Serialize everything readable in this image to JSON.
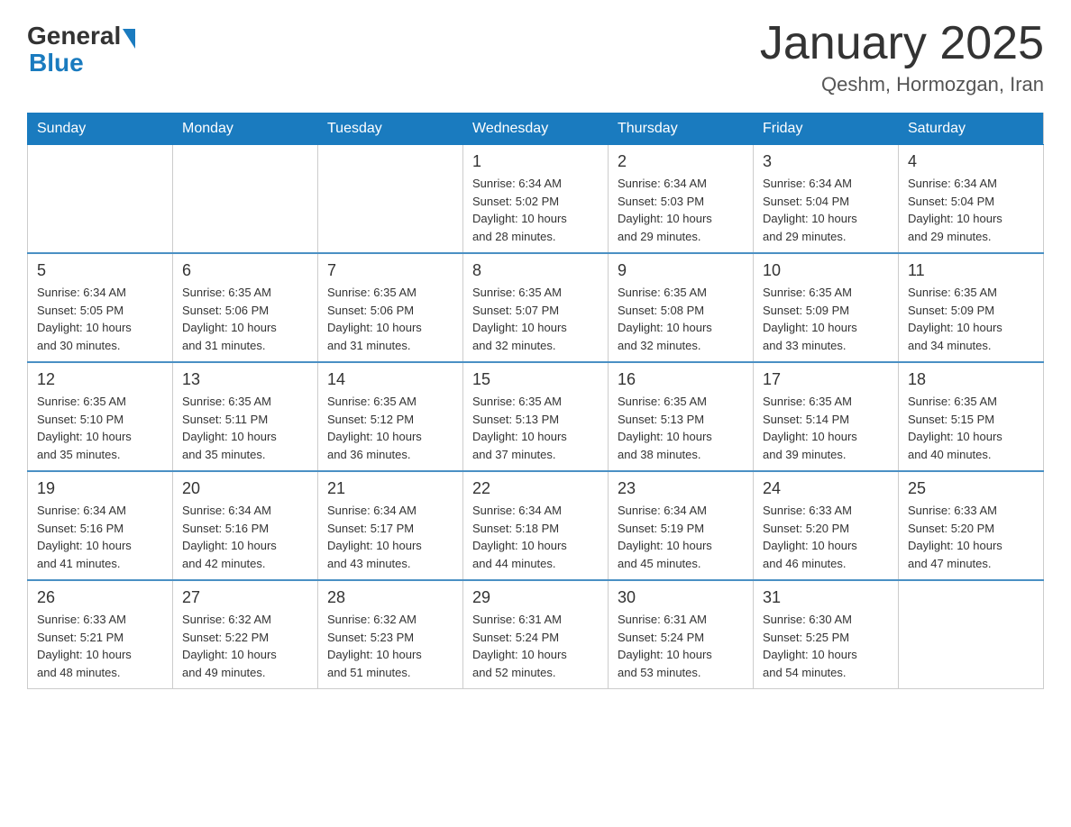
{
  "header": {
    "logo": {
      "general": "General",
      "blue": "Blue",
      "line2": "Blue"
    },
    "title": "January 2025",
    "location": "Qeshm, Hormozgan, Iran"
  },
  "days_of_week": [
    "Sunday",
    "Monday",
    "Tuesday",
    "Wednesday",
    "Thursday",
    "Friday",
    "Saturday"
  ],
  "weeks": [
    [
      {
        "day": "",
        "info": ""
      },
      {
        "day": "",
        "info": ""
      },
      {
        "day": "",
        "info": ""
      },
      {
        "day": "1",
        "info": "Sunrise: 6:34 AM\nSunset: 5:02 PM\nDaylight: 10 hours\nand 28 minutes."
      },
      {
        "day": "2",
        "info": "Sunrise: 6:34 AM\nSunset: 5:03 PM\nDaylight: 10 hours\nand 29 minutes."
      },
      {
        "day": "3",
        "info": "Sunrise: 6:34 AM\nSunset: 5:04 PM\nDaylight: 10 hours\nand 29 minutes."
      },
      {
        "day": "4",
        "info": "Sunrise: 6:34 AM\nSunset: 5:04 PM\nDaylight: 10 hours\nand 29 minutes."
      }
    ],
    [
      {
        "day": "5",
        "info": "Sunrise: 6:34 AM\nSunset: 5:05 PM\nDaylight: 10 hours\nand 30 minutes."
      },
      {
        "day": "6",
        "info": "Sunrise: 6:35 AM\nSunset: 5:06 PM\nDaylight: 10 hours\nand 31 minutes."
      },
      {
        "day": "7",
        "info": "Sunrise: 6:35 AM\nSunset: 5:06 PM\nDaylight: 10 hours\nand 31 minutes."
      },
      {
        "day": "8",
        "info": "Sunrise: 6:35 AM\nSunset: 5:07 PM\nDaylight: 10 hours\nand 32 minutes."
      },
      {
        "day": "9",
        "info": "Sunrise: 6:35 AM\nSunset: 5:08 PM\nDaylight: 10 hours\nand 32 minutes."
      },
      {
        "day": "10",
        "info": "Sunrise: 6:35 AM\nSunset: 5:09 PM\nDaylight: 10 hours\nand 33 minutes."
      },
      {
        "day": "11",
        "info": "Sunrise: 6:35 AM\nSunset: 5:09 PM\nDaylight: 10 hours\nand 34 minutes."
      }
    ],
    [
      {
        "day": "12",
        "info": "Sunrise: 6:35 AM\nSunset: 5:10 PM\nDaylight: 10 hours\nand 35 minutes."
      },
      {
        "day": "13",
        "info": "Sunrise: 6:35 AM\nSunset: 5:11 PM\nDaylight: 10 hours\nand 35 minutes."
      },
      {
        "day": "14",
        "info": "Sunrise: 6:35 AM\nSunset: 5:12 PM\nDaylight: 10 hours\nand 36 minutes."
      },
      {
        "day": "15",
        "info": "Sunrise: 6:35 AM\nSunset: 5:13 PM\nDaylight: 10 hours\nand 37 minutes."
      },
      {
        "day": "16",
        "info": "Sunrise: 6:35 AM\nSunset: 5:13 PM\nDaylight: 10 hours\nand 38 minutes."
      },
      {
        "day": "17",
        "info": "Sunrise: 6:35 AM\nSunset: 5:14 PM\nDaylight: 10 hours\nand 39 minutes."
      },
      {
        "day": "18",
        "info": "Sunrise: 6:35 AM\nSunset: 5:15 PM\nDaylight: 10 hours\nand 40 minutes."
      }
    ],
    [
      {
        "day": "19",
        "info": "Sunrise: 6:34 AM\nSunset: 5:16 PM\nDaylight: 10 hours\nand 41 minutes."
      },
      {
        "day": "20",
        "info": "Sunrise: 6:34 AM\nSunset: 5:16 PM\nDaylight: 10 hours\nand 42 minutes."
      },
      {
        "day": "21",
        "info": "Sunrise: 6:34 AM\nSunset: 5:17 PM\nDaylight: 10 hours\nand 43 minutes."
      },
      {
        "day": "22",
        "info": "Sunrise: 6:34 AM\nSunset: 5:18 PM\nDaylight: 10 hours\nand 44 minutes."
      },
      {
        "day": "23",
        "info": "Sunrise: 6:34 AM\nSunset: 5:19 PM\nDaylight: 10 hours\nand 45 minutes."
      },
      {
        "day": "24",
        "info": "Sunrise: 6:33 AM\nSunset: 5:20 PM\nDaylight: 10 hours\nand 46 minutes."
      },
      {
        "day": "25",
        "info": "Sunrise: 6:33 AM\nSunset: 5:20 PM\nDaylight: 10 hours\nand 47 minutes."
      }
    ],
    [
      {
        "day": "26",
        "info": "Sunrise: 6:33 AM\nSunset: 5:21 PM\nDaylight: 10 hours\nand 48 minutes."
      },
      {
        "day": "27",
        "info": "Sunrise: 6:32 AM\nSunset: 5:22 PM\nDaylight: 10 hours\nand 49 minutes."
      },
      {
        "day": "28",
        "info": "Sunrise: 6:32 AM\nSunset: 5:23 PM\nDaylight: 10 hours\nand 51 minutes."
      },
      {
        "day": "29",
        "info": "Sunrise: 6:31 AM\nSunset: 5:24 PM\nDaylight: 10 hours\nand 52 minutes."
      },
      {
        "day": "30",
        "info": "Sunrise: 6:31 AM\nSunset: 5:24 PM\nDaylight: 10 hours\nand 53 minutes."
      },
      {
        "day": "31",
        "info": "Sunrise: 6:30 AM\nSunset: 5:25 PM\nDaylight: 10 hours\nand 54 minutes."
      },
      {
        "day": "",
        "info": ""
      }
    ]
  ]
}
